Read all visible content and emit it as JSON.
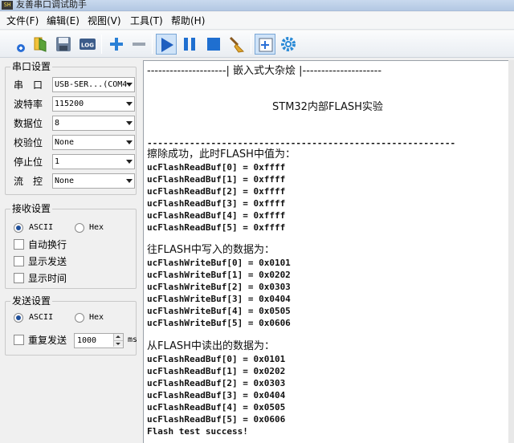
{
  "window": {
    "title": "友善串口调试助手",
    "app_icon_text": "SH"
  },
  "menu": [
    "文件(F)",
    "编辑(E)",
    "视图(V)",
    "工具(T)",
    "帮助(H)"
  ],
  "toolbar": {
    "log_label": "LOG",
    "icons": [
      "new-icon",
      "open-icon",
      "save-icon",
      "log-icon",
      "add-icon",
      "remove-icon",
      "play-icon",
      "pause-icon",
      "stop-icon",
      "clear-brush-icon",
      "new-window-icon",
      "settings-icon"
    ]
  },
  "serial_settings": {
    "title": "串口设置",
    "port_label": "串　口",
    "port_value": "USB-SER...(COM4",
    "baud_label": "波特率",
    "baud_value": "115200",
    "data_bits_label": "数据位",
    "data_bits_value": "8",
    "parity_label": "校验位",
    "parity_value": "None",
    "stop_bits_label": "停止位",
    "stop_bits_value": "1",
    "flow_label": "流　控",
    "flow_value": "None"
  },
  "receive_settings": {
    "title": "接收设置",
    "ascii_label": "ASCII",
    "hex_label": "Hex",
    "auto_wrap_label": "自动换行",
    "show_send_label": "显示发送",
    "show_time_label": "显示时间"
  },
  "send_settings": {
    "title": "发送设置",
    "ascii_label": "ASCII",
    "hex_label": "Hex",
    "repeat_label": "重复发送",
    "interval_value": "1000",
    "unit_label": "ms"
  },
  "terminal_lines": [
    "---------------------| 嵌入式大杂烩 |---------------------",
    "",
    "STM32内部FLASH实验",
    "",
    "----------------------------------------------------------",
    "擦除成功，此时FLASH中值为：",
    "ucFlashReadBuf[0] = 0xffff",
    "ucFlashReadBuf[1] = 0xffff",
    "ucFlashReadBuf[2] = 0xffff",
    "ucFlashReadBuf[3] = 0xffff",
    "ucFlashReadBuf[4] = 0xffff",
    "ucFlashReadBuf[5] = 0xffff",
    "",
    "往FLASH中写入的数据为：",
    "ucFlashWriteBuf[0] = 0x0101",
    "ucFlashWriteBuf[1] = 0x0202",
    "ucFlashWriteBuf[2] = 0x0303",
    "ucFlashWriteBuf[3] = 0x0404",
    "ucFlashWriteBuf[4] = 0x0505",
    "ucFlashWriteBuf[5] = 0x0606",
    "",
    "从FLASH中读出的数据为：",
    "ucFlashReadBuf[0] = 0x0101",
    "ucFlashReadBuf[1] = 0x0202",
    "ucFlashReadBuf[2] = 0x0303",
    "ucFlashReadBuf[3] = 0x0404",
    "ucFlashReadBuf[4] = 0x0505",
    "ucFlashReadBuf[5] = 0x0606",
    "Flash test success!"
  ]
}
